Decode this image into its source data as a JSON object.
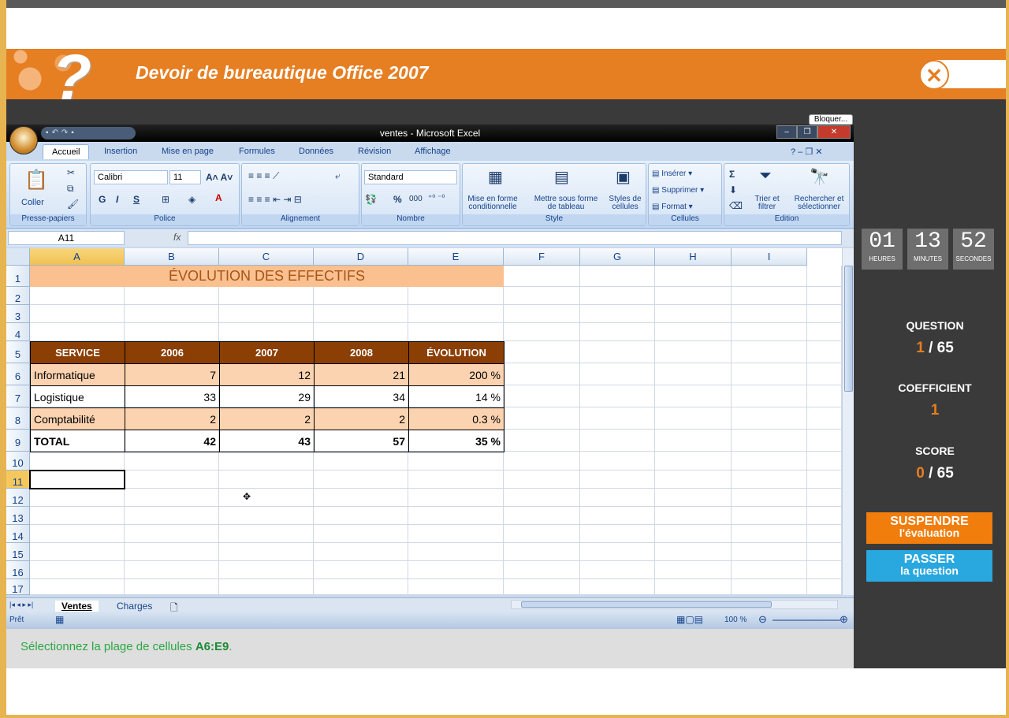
{
  "header": {
    "title": "Devoir de bureautique Office 2007",
    "close_icon": "close-icon"
  },
  "excel": {
    "window_title": "ventes - Microsoft Excel",
    "bloquer": "Bloquer...",
    "tabs": [
      "Accueil",
      "Insertion",
      "Mise en page",
      "Formules",
      "Données",
      "Révision",
      "Affichage"
    ],
    "ribbon": {
      "clipboard": {
        "paste": "Coller",
        "label": "Presse-papiers"
      },
      "font": {
        "name": "Calibri",
        "size": "11",
        "label": "Police",
        "bold": "G",
        "italic": "I",
        "underline": "S"
      },
      "alignment": {
        "label": "Alignement"
      },
      "number": {
        "format": "Standard",
        "label": "Nombre",
        "percent": "%",
        "thousands": "000"
      },
      "style": {
        "label": "Style",
        "cond_format": "Mise en forme conditionnelle",
        "table_format": "Mettre sous forme de tableau",
        "cell_styles": "Styles de cellules"
      },
      "cells": {
        "label": "Cellules",
        "insert": "Insérer",
        "delete": "Supprimer",
        "format": "Format"
      },
      "editing": {
        "label": "Edition",
        "sort": "Trier et filtrer",
        "find": "Rechercher et sélectionner",
        "sum": "Σ"
      }
    },
    "namebox": "A11",
    "fx": "fx",
    "columns": [
      "A",
      "B",
      "C",
      "D",
      "E",
      "F",
      "G",
      "H",
      "I"
    ],
    "rows": [
      "1",
      "2",
      "3",
      "4",
      "5",
      "6",
      "7",
      "8",
      "9",
      "10",
      "11",
      "12",
      "13",
      "14",
      "15",
      "16",
      "17"
    ],
    "table": {
      "title": "ÉVOLUTION DES EFFECTIFS",
      "headers": [
        "SERVICE",
        "2006",
        "2007",
        "2008",
        "ÉVOLUTION"
      ],
      "body": [
        [
          "Informatique",
          "7",
          "12",
          "21",
          "200 %"
        ],
        [
          "Logistique",
          "33",
          "29",
          "34",
          "14 %"
        ],
        [
          "Comptabilité",
          "2",
          "2",
          "2",
          "0.3 %"
        ]
      ],
      "total": [
        "TOTAL",
        "42",
        "43",
        "57",
        "35 %"
      ]
    },
    "sheets": [
      "Ventes",
      "Charges"
    ],
    "status": "Prêt",
    "zoom": "100 %"
  },
  "instruction": {
    "text": "Sélectionnez la plage de cellules ",
    "range": "A6:E9",
    "end": "."
  },
  "timer": {
    "hours": "01",
    "minutes": "13",
    "seconds": "52",
    "hours_label": "HEURES",
    "minutes_label": "MINUTES",
    "seconds_label": "SECONDES"
  },
  "sidebar": {
    "question_label": "QUESTION",
    "question_current": "1",
    "question_total": " / 65",
    "coef_label": "COEFFICIENT",
    "coef_value": "1",
    "score_label": "SCORE",
    "score_current": "0",
    "score_total": " / 65",
    "suspend_a": "SUSPENDRE",
    "suspend_b": "l'évaluation",
    "pass_a": "PASSER",
    "pass_b": "la question"
  },
  "colors": {
    "orange": "#e67e22",
    "dark": "#3a3a3a",
    "header_brown": "#8b3f05",
    "peach": "#fbd3b0",
    "blue_btn": "#29a8e0"
  }
}
